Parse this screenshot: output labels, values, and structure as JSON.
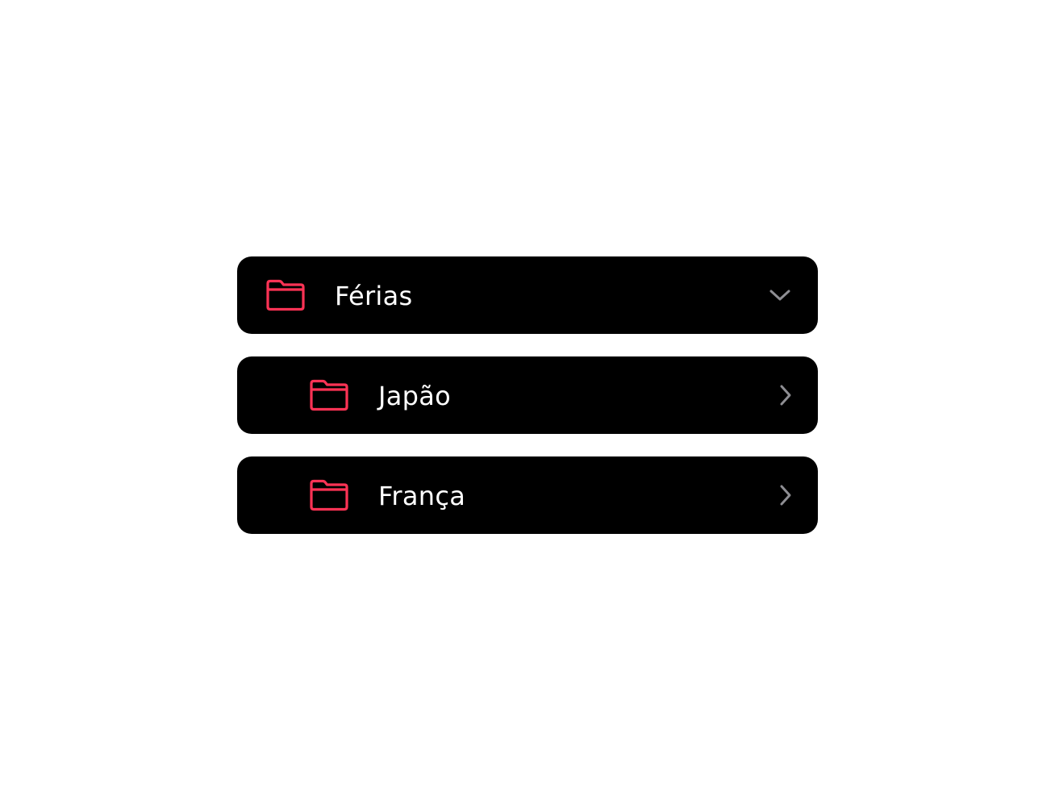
{
  "colors": {
    "background": "#ffffff",
    "row_background": "#000000",
    "icon_accent": "#ff3355",
    "label": "#ffffff",
    "chevron": "#8e8e93"
  },
  "folders": [
    {
      "label": "Férias",
      "icon": "folder-icon",
      "state": "expanded",
      "chevron_icon": "chevron-down-icon"
    },
    {
      "label": "Japão",
      "icon": "folder-icon",
      "state": "collapsed",
      "chevron_icon": "chevron-right-icon"
    },
    {
      "label": "França",
      "icon": "folder-icon",
      "state": "collapsed",
      "chevron_icon": "chevron-right-icon"
    }
  ]
}
